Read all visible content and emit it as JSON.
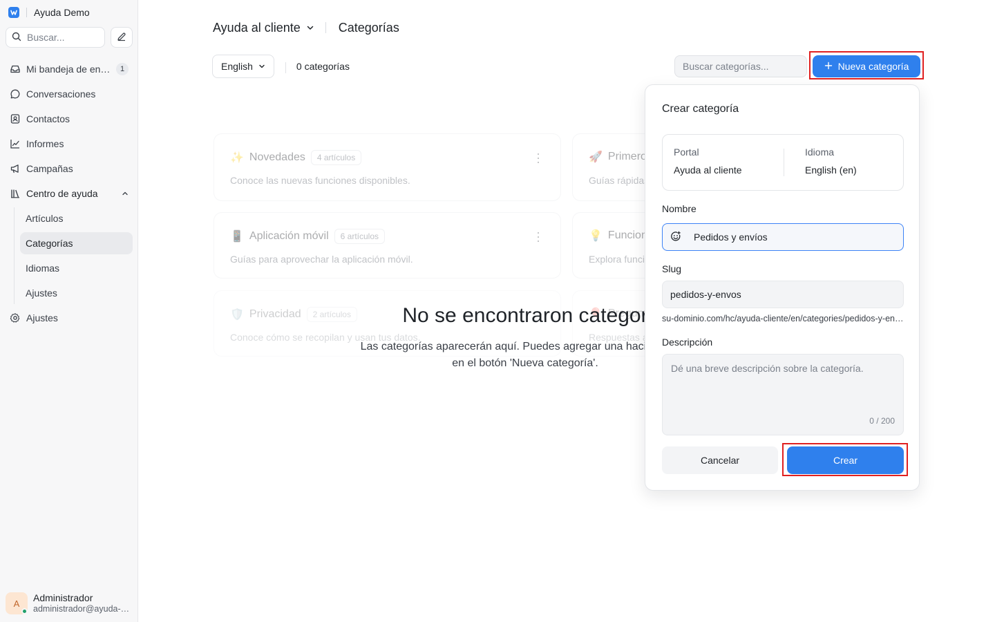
{
  "app": {
    "name": "Ayuda Demo"
  },
  "sidebar": {
    "search_placeholder": "Buscar...",
    "items": [
      {
        "label": "Mi bandeja de entrada",
        "badge": "1"
      },
      {
        "label": "Conversaciones"
      },
      {
        "label": "Contactos"
      },
      {
        "label": "Informes"
      },
      {
        "label": "Campañas"
      },
      {
        "label": "Centro de ayuda"
      }
    ],
    "subitems": [
      {
        "label": "Artículos"
      },
      {
        "label": "Categorías"
      },
      {
        "label": "Idiomas"
      },
      {
        "label": "Ajustes"
      }
    ],
    "settings_label": "Ajustes",
    "user": {
      "initial": "A",
      "name": "Administrador",
      "email": "administrador@ayuda-demo.com"
    }
  },
  "header": {
    "portal": "Ayuda al cliente",
    "page_title": "Categorías"
  },
  "toolbar": {
    "language": "English",
    "count": "0 categorías",
    "search_placeholder": "Buscar categorías...",
    "new_button": "Nueva categoría"
  },
  "background_cards": [
    {
      "emoji": "✨",
      "title": "Novedades",
      "badge": "4 artículos",
      "desc": "Conoce las nuevas funciones disponibles."
    },
    {
      "emoji": "🚀",
      "title": "Primeros pasos",
      "desc": "Guías rápidas para comenzar."
    },
    {
      "emoji": "📱",
      "title": "Aplicación móvil",
      "badge": "6 artículos",
      "desc": "Guías para aprovechar la aplicación móvil."
    },
    {
      "emoji": "💡",
      "title": "Funciones",
      "desc": "Explora funciones avanzadas."
    },
    {
      "emoji": "🛡️",
      "title": "Privacidad",
      "badge": "2 artículos",
      "desc": "Conoce cómo se recopilan y usan tus datos."
    },
    {
      "emoji": "🎈",
      "title": "Preguntas",
      "desc": "Respuestas a preguntas frecuentes."
    }
  ],
  "empty_state": {
    "title": "No se encontraron categorías",
    "subtitle": "Las categorías aparecerán aquí. Puedes agregar una haciendo clic en el botón 'Nueva categoría'."
  },
  "dialog": {
    "title": "Crear categoría",
    "portal_label": "Portal",
    "portal_value": "Ayuda al cliente",
    "language_label": "Idioma",
    "language_value": "English (en)",
    "name_label": "Nombre",
    "name_value": "Pedidos y envíos",
    "slug_label": "Slug",
    "slug_value": "pedidos-y-envos",
    "slug_hint": "su-dominio.com/hc/ayuda-cliente/en/categories/pedidos-y-envos",
    "description_label": "Descripción",
    "description_placeholder": "Dé una breve descripción sobre la categoría.",
    "char_count": "0 / 200",
    "cancel": "Cancelar",
    "create": "Crear"
  },
  "colors": {
    "primary": "#2f80ed",
    "highlight": "#e02020",
    "online": "#22a06b"
  }
}
